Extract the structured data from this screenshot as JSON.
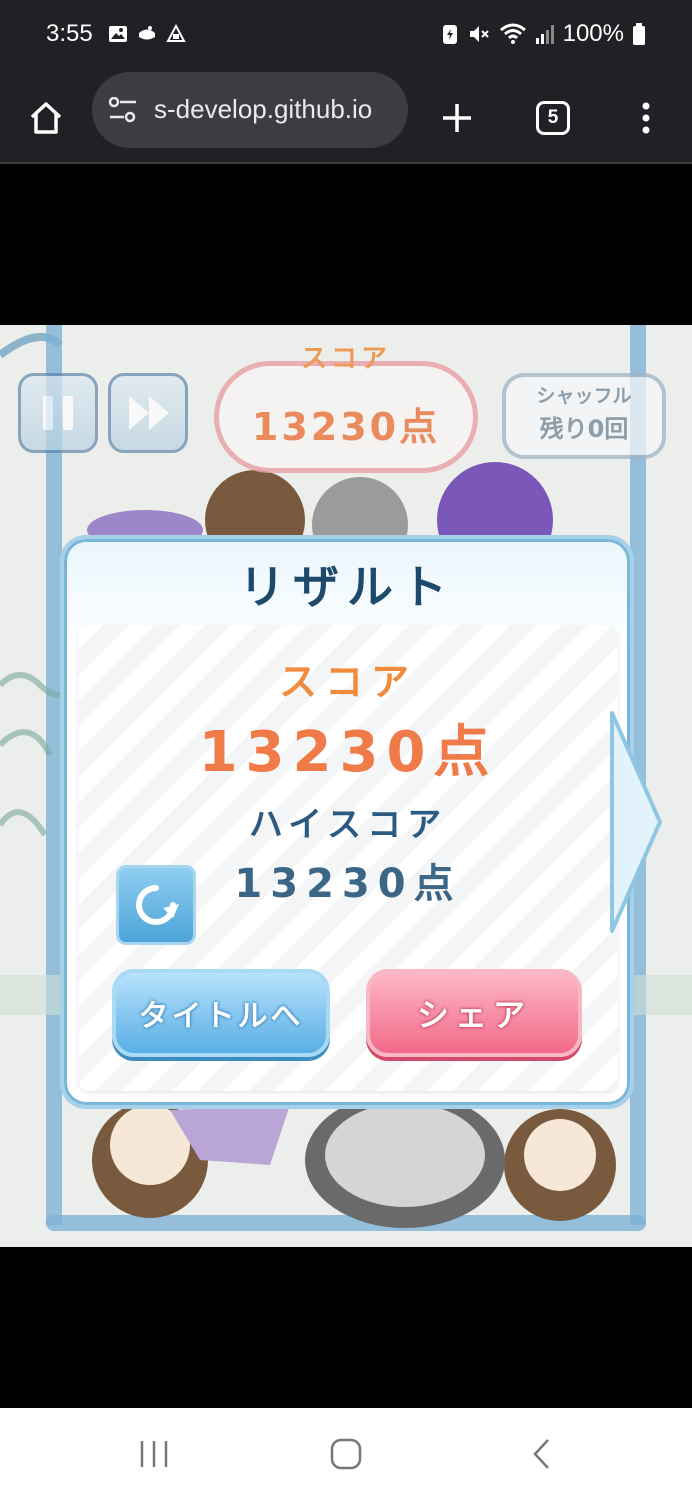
{
  "status_bar": {
    "time": "3:55",
    "battery": "100%",
    "icons": [
      "gallery-icon",
      "chat-icon",
      "app-icon",
      "battery-saver-icon",
      "mute-icon",
      "wifi-icon",
      "signal-icon",
      "battery-icon"
    ]
  },
  "browser": {
    "url": "s-develop.github.io",
    "tab_count": "5",
    "icons": [
      "home-icon",
      "site-settings-icon",
      "new-tab-icon",
      "tab-switcher-icon",
      "menu-icon"
    ]
  },
  "hud": {
    "score_label": "スコア",
    "score_value": "13230点",
    "shuffle_label": "シャッフル",
    "shuffle_remaining": "残り0回"
  },
  "result": {
    "title": "リザルト",
    "score_label": "スコア",
    "score_value": "13230点",
    "highscore_label": "ハイスコア",
    "highscore_value": "13230点",
    "to_title_button": "タイトルへ",
    "share_button": "シェア"
  },
  "colors": {
    "score_orange": "#f07a48",
    "title_navy": "#1d4a6b",
    "button_blue": "#5aaee6",
    "button_pink": "#f26a89"
  }
}
